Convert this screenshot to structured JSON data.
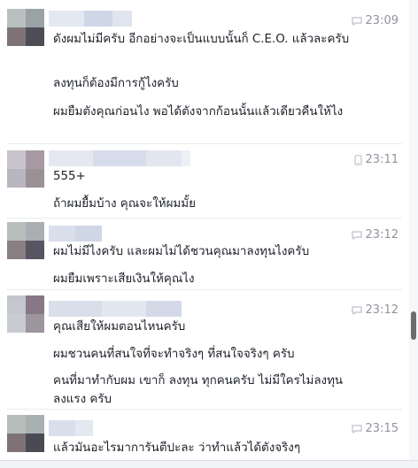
{
  "groups": [
    {
      "time": "23:09",
      "time_icon": "comment-icon",
      "messages": [
        "ดังผมไม่มีครับ อีกอย่างจะเป็นแบบนั้นก็ C.E.O. แล้วละครับ",
        "ลงทุนก็ต้องมีการกู้ไงครับ",
        "ผมยืมตังคุณก่อนไง พอได้ตังจากก้อนนั้นแล้วเดียวคืนให้ไง"
      ]
    },
    {
      "time": "23:11",
      "time_icon": "mobile-phone-icon",
      "messages": [
        "555+",
        "ถ้าผมยื้มบ้าง คุณจะให้ผมมั้ย"
      ]
    },
    {
      "time": "23:12",
      "time_icon": "comment-icon",
      "messages": [
        "ผมไม่มีไงครับ และผมไม่ได้ชวนคุณมาลงทุนไงครับ",
        "ผมยืมเพราะเสียเงินให้คุณไง"
      ]
    },
    {
      "time": "23:12",
      "time_icon": "comment-icon",
      "messages": [
        "คุณเสียให้ผมตอนไหนครับ",
        "ผมชวนคนที่สนใจที่จะทำจริงๆ ที่สนใจจริงๆ ครับ",
        "คนที่มาทำกับผม เขาก็ ลงทุน ทุกคนครับ ไม่มีใครไม่ลงทุน ลงแรง ครับ"
      ]
    },
    {
      "time": "23:15",
      "time_icon": "comment-icon",
      "messages": [
        "แล้วมันอะไรมาการันตีปะละ ว่าทำแล้วได้ตังจริงๆ"
      ]
    }
  ],
  "colors": {
    "timestamp": "#90949c",
    "message_text": "#1d2129",
    "divider": "#e9ebee",
    "scroll_thumb": "#6d6d6d"
  }
}
